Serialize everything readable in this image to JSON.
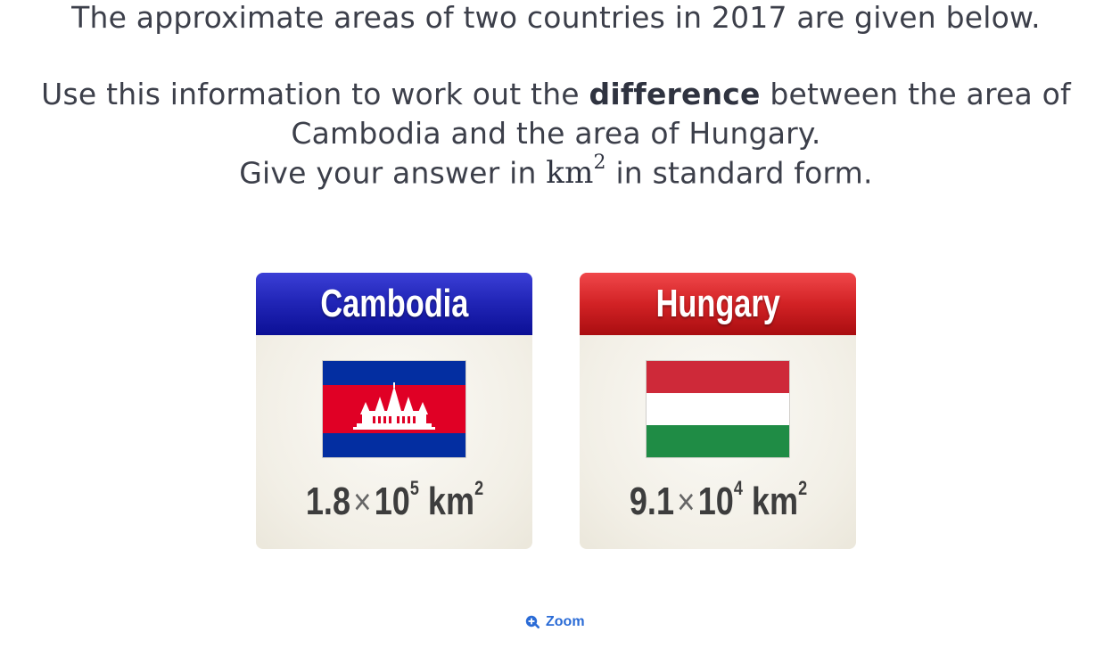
{
  "question": {
    "line1": "The approximate areas of two countries in 2017 are given below.",
    "line2_pre": "Use this information to work out the ",
    "line2_bold": "difference",
    "line2_post": " between the area of",
    "line3": "Cambodia and the area of Hungary.",
    "line4_pre": "Give your answer in ",
    "line4_unit": "km",
    "line4_exp": "2",
    "line4_post": " in standard form."
  },
  "cards": [
    {
      "country": "Cambodia",
      "mantissa": "1.8",
      "times": "×",
      "base": "10",
      "exponent": "5",
      "unit": "km",
      "unit_exp": "2",
      "header_color": "#1c20a8",
      "flag_colors": [
        "#032ea1",
        "#e00025",
        "#ffffff"
      ]
    },
    {
      "country": "Hungary",
      "mantissa": "9.1",
      "times": "×",
      "base": "10",
      "exponent": "4",
      "unit": "km",
      "unit_exp": "2",
      "header_color": "#c8191c",
      "flag_colors": [
        "#ce2939",
        "#ffffff",
        "#477050"
      ]
    }
  ],
  "zoom": {
    "label": "Zoom",
    "icon": "zoom-in-icon",
    "color": "#2a6bd6"
  }
}
